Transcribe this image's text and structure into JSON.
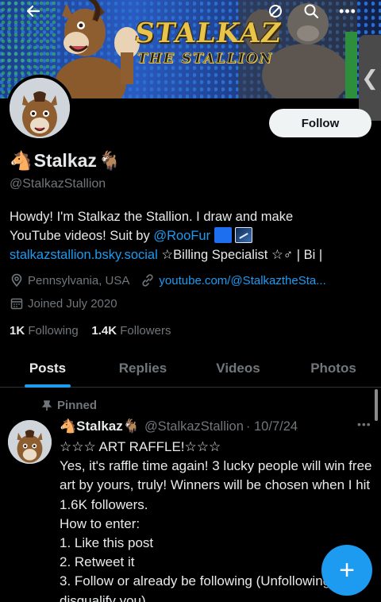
{
  "banner": {
    "title": "STALKAZ",
    "subtitle": "THE STALLION"
  },
  "header": {
    "back_icon": "arrow-left-icon",
    "sync_icon": "sync-icon",
    "search_icon": "search-icon",
    "more_icon": "more-horizontal-icon"
  },
  "profile": {
    "display_name": "Stalkaz",
    "name_prefix_emoji": "🐴",
    "name_suffix_emoji": "🐐",
    "handle": "@StalkazStallion",
    "follow_label": "Follow",
    "bio_line1": "Howdy! I'm Stalkaz the Stallion. I draw and make",
    "bio_line2_text": "YouTube videos! Suit by ",
    "bio_mention": "@RooFur",
    "bio_link": "stalkazstallion.bsky.social",
    "bio_line3_rest": " ☆Billing Specialist ☆♂ | Bi |",
    "location": "Pennsylvania, USA",
    "website": "youtube.com/@StalkaztheSta...",
    "joined": "Joined July 2020",
    "following_count": "1K",
    "following_label": "Following",
    "followers_count": "1.4K",
    "followers_label": "Followers"
  },
  "tabs": [
    {
      "label": "Posts",
      "active": true
    },
    {
      "label": "Replies",
      "active": false
    },
    {
      "label": "Videos",
      "active": false
    },
    {
      "label": "Photos",
      "active": false
    }
  ],
  "post": {
    "pinned_label": "Pinned",
    "author_name": "Stalkaz",
    "author_prefix_emoji": "🐴",
    "author_suffix_emoji": "🐐",
    "author_handle": "@StalkazStallion",
    "date": "· 10/7/24",
    "more_icon": "more-horizontal-icon",
    "body": "☆☆☆ ART RAFFLE!☆☆☆\nYes, it's raffle time again! 3 lucky people will win free art by yours, truly! Winners will be chosen when I hit 1.6K followers.\nHow to enter:\n1. Like this post\n2. Retweet it\n3. Follow or already be following (Unfollowing will disqualify you)"
  },
  "fab": {
    "label": "+",
    "icon": "plus-icon"
  },
  "colors": {
    "accent": "#1d9bf0",
    "background": "#000000",
    "text_primary": "#e7e9ea",
    "text_secondary": "#71767b",
    "follow_button_bg": "#eff3f4"
  }
}
